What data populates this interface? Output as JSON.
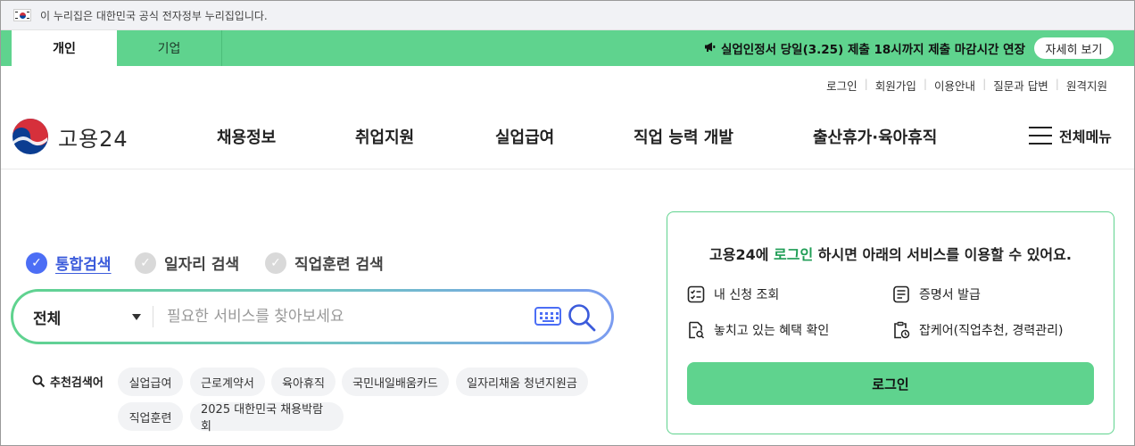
{
  "gov_banner": {
    "text": "이 누리집은 대한민국 공식 전자정부 누리집입니다."
  },
  "topbar": {
    "tabs": [
      {
        "label": "개인",
        "active": true
      },
      {
        "label": "기업",
        "active": false
      }
    ],
    "notice": "실업인정서 당일(3.25) 제출 18시까지 제출 마감시간 연장",
    "detail_button": "자세히 보기",
    "color": "#5fd38e"
  },
  "utility_links": [
    "로그인",
    "회원가입",
    "이용안내",
    "질문과 답변",
    "원격지원"
  ],
  "logo": {
    "text": "고용24"
  },
  "nav": [
    "채용정보",
    "취업지원",
    "실업급여",
    "직업 능력 개발",
    "출산휴가·육아휴직"
  ],
  "all_menu": "전체메뉴",
  "search": {
    "tabs": [
      {
        "label": "통합검색",
        "active": true
      },
      {
        "label": "일자리 검색",
        "active": false
      },
      {
        "label": "직업훈련 검색",
        "active": false
      }
    ],
    "scope": "전체",
    "placeholder": "필요한 서비스를 찾아보세요",
    "accent": "#4c6ef5"
  },
  "keywords": {
    "title": "추천검색어",
    "items": [
      "실업급여",
      "근로계약서",
      "육아휴직",
      "국민내일배움카드",
      "일자리채움 청년지원금",
      "직업훈련",
      "2025 대한민국 채용박람회"
    ]
  },
  "login_card": {
    "heading_prefix": "고용24에 ",
    "heading_highlight": "로그인",
    "heading_suffix": " 하시면 아래의 서비스를 이용할 수 있어요.",
    "services": [
      "내 신청 조회",
      "증명서 발급",
      "놓치고 있는 혜택 확인",
      "잡케어(직업추천, 경력관리)"
    ],
    "button": "로그인"
  }
}
